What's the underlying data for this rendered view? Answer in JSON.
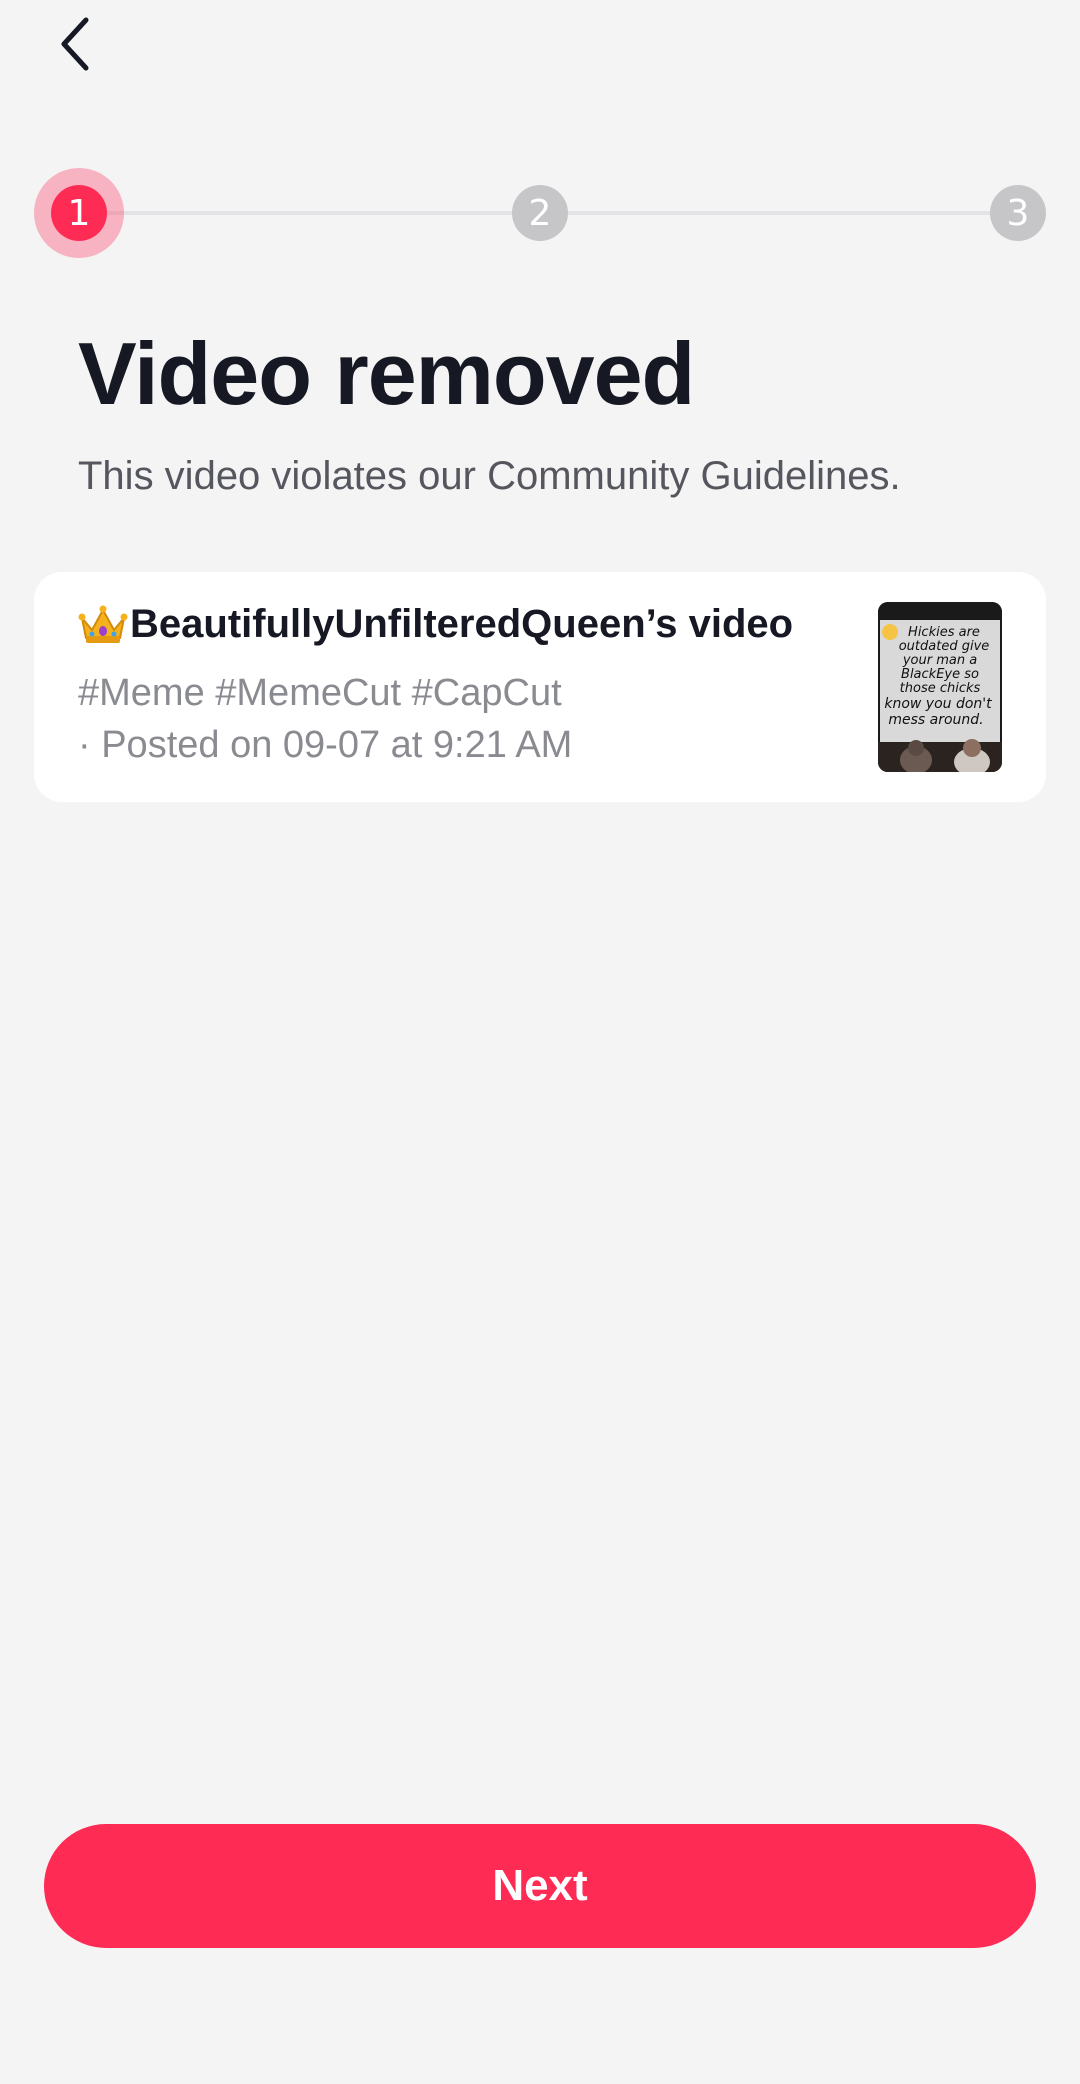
{
  "header": {
    "back_icon": "chevron-left-icon"
  },
  "stepper": {
    "steps": [
      "1",
      "2",
      "3"
    ],
    "active_step": 1,
    "active_color": "#fe2c55",
    "inactive_color": "#c6c6c9"
  },
  "main": {
    "title": "Video removed",
    "subtitle": "This video violates our Community Guidelines."
  },
  "video_card": {
    "title_emoji": "crown-icon",
    "title": "BeautifullyUnfilteredQueen’s video",
    "tags": "#Meme #MemeCut #CapCut",
    "posted": "· Posted on 09-07 at 9:21 AM",
    "thumbnail_text": [
      "Hickies are",
      "outdated give",
      "your man a",
      "BlackEye so",
      "those chicks",
      "know you don't",
      "mess around."
    ]
  },
  "footer": {
    "next_label": "Next",
    "accent_color": "#fe2c55"
  }
}
